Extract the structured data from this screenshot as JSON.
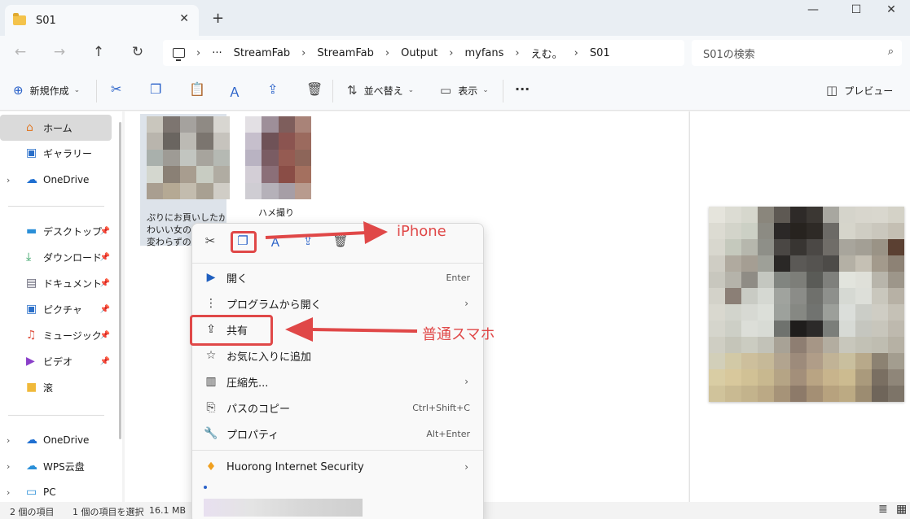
{
  "window": {
    "tab_title": "S01",
    "tab_close": "✕",
    "new_tab": "+",
    "minimize": "—",
    "maximize": "☐",
    "close": "✕"
  },
  "address": {
    "more": "···",
    "crumbs": [
      "StreamFab",
      "StreamFab",
      "Output",
      "myfans",
      "えむ。",
      "S01"
    ],
    "separator": "›",
    "search_placeholder": "S01の検索"
  },
  "command_bar": {
    "new_label": "新規作成",
    "sort_label": "並べ替え",
    "view_label": "表示",
    "more": "···",
    "preview_label": "プレビュー"
  },
  "sidebar": {
    "items": [
      {
        "label": "ホーム",
        "icon": "home-icon"
      },
      {
        "label": "ギャラリー",
        "icon": "gallery-icon"
      },
      {
        "label": "OneDrive",
        "icon": "cloud-icon"
      },
      {
        "label": "デスクトップ",
        "icon": "desktop-icon"
      },
      {
        "label": "ダウンロード",
        "icon": "download-icon"
      },
      {
        "label": "ドキュメント",
        "icon": "document-icon"
      },
      {
        "label": "ピクチャ",
        "icon": "picture-icon"
      },
      {
        "label": "ミュージック",
        "icon": "music-icon"
      },
      {
        "label": "ビデオ",
        "icon": "video-icon"
      },
      {
        "label": "滚",
        "icon": "folder-icon"
      },
      {
        "label": "OneDrive",
        "icon": "cloud-icon"
      },
      {
        "label": "WPS云盘",
        "icon": "cloud-icon"
      },
      {
        "label": "PC",
        "icon": "pc-icon"
      }
    ]
  },
  "files": [
    {
      "name_lines": [
        "ぷりにお頁いしたか",
        "わいい女の子が服",
        "変わらずの"
      ]
    },
    {
      "name_lines": [
        "ハメ撮り"
      ]
    }
  ],
  "context_menu": {
    "items": [
      {
        "label": "開く",
        "accel": "Enter",
        "icon": "media-player-icon"
      },
      {
        "label": "プログラムから開く",
        "submenu": "›",
        "icon": "open-with-icon"
      },
      {
        "label": "共有",
        "icon": "share-icon"
      },
      {
        "label": "お気に入りに追加",
        "icon": "star-icon"
      },
      {
        "label": "圧縮先...",
        "submenu": "›",
        "icon": "zip-icon"
      },
      {
        "label": "パスのコピー",
        "accel": "Ctrl+Shift+C",
        "icon": "copy-path-icon"
      },
      {
        "label": "プロパティ",
        "accel": "Alt+Enter",
        "icon": "wrench-icon"
      },
      {
        "label": "Huorong Internet Security",
        "submenu": "›",
        "icon": "huorong-icon"
      }
    ]
  },
  "annotations": {
    "iphone": "iPhone",
    "normal": "普通スマホ",
    "color": "#e04848"
  },
  "status": {
    "count": "2 個の項目",
    "selection": "1 個の項目を選択",
    "size": "16.1 MB"
  }
}
